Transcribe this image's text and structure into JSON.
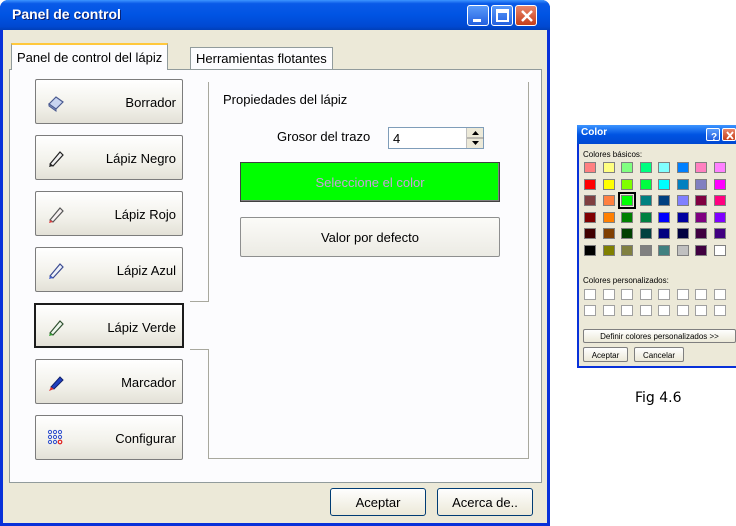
{
  "window": {
    "title": "Panel de control"
  },
  "tabs": [
    {
      "label": "Panel de control del lápiz",
      "active": true
    },
    {
      "label": "Herramientas flotantes",
      "active": false
    }
  ],
  "pens": [
    {
      "label": "Borrador",
      "icon": "eraser-icon",
      "color": "#6f7fa8"
    },
    {
      "label": "Lápiz Negro",
      "icon": "pencil-icon",
      "color": "#222222"
    },
    {
      "label": "Lápiz Rojo",
      "icon": "pencil-icon",
      "color": "#e04040"
    },
    {
      "label": "Lápiz Azul",
      "icon": "pencil-icon",
      "color": "#4060d0"
    },
    {
      "label": "Lápiz Verde",
      "icon": "pencil-icon",
      "color": "#30a030",
      "selected": true
    },
    {
      "label": "Marcador",
      "icon": "marker-icon",
      "color": "#2040c0"
    },
    {
      "label": "Configurar",
      "icon": "dots-grid-icon",
      "color": "#3050d0"
    }
  ],
  "properties": {
    "title": "Propiedades del lápiz",
    "stroke_label": "Grosor del trazo",
    "stroke_value": "4",
    "color_button": "Seleccione el color",
    "color_value": "#00ff00",
    "default_button": "Valor por defecto"
  },
  "footer": {
    "ok": "Aceptar",
    "about": "Acerca de.."
  },
  "color_dialog": {
    "title": "Color",
    "basic_label": "Colores básicos:",
    "custom_label": "Colores personalizados:",
    "define_button": "Definir colores personalizados >>",
    "ok": "Aceptar",
    "cancel": "Cancelar",
    "basic_colors": [
      [
        "#ff8080",
        "#ffff80",
        "#80ff80",
        "#00ff80",
        "#80ffff",
        "#0080ff",
        "#ff80c0",
        "#ff80ff"
      ],
      [
        "#ff0000",
        "#ffff00",
        "#80ff00",
        "#00ff40",
        "#00ffff",
        "#0080c0",
        "#8080c0",
        "#ff00ff"
      ],
      [
        "#804040",
        "#ff8040",
        "#00ff00",
        "#008080",
        "#004080",
        "#8080ff",
        "#800040",
        "#ff0080"
      ],
      [
        "#800000",
        "#ff8000",
        "#008000",
        "#008040",
        "#0000ff",
        "#0000a0",
        "#800080",
        "#8000ff"
      ],
      [
        "#400000",
        "#804000",
        "#004000",
        "#004040",
        "#000080",
        "#000040",
        "#400040",
        "#400080"
      ],
      [
        "#000000",
        "#808000",
        "#808040",
        "#808080",
        "#408080",
        "#c0c0c0",
        "#400040",
        "#ffffff"
      ]
    ],
    "selected_swatch": "#00ff00"
  },
  "caption": "Fig 4.6"
}
